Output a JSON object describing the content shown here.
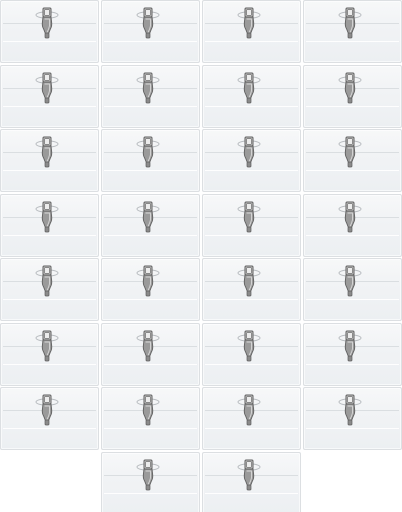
{
  "scene": {
    "subject": "badge-holders-with-clips",
    "grid_columns": 4,
    "grid_rows_full": 7,
    "last_row_count": 2,
    "colors": {
      "background": "#ffffff",
      "holder_fill": "#f1f3f5",
      "holder_border": "#dcdfe2",
      "clip_metal": "#9a9a9a",
      "clip_dark": "#5f5f5f"
    },
    "icons": {
      "clip": "metal-clip-icon",
      "pin": "safety-pin-icon"
    }
  }
}
